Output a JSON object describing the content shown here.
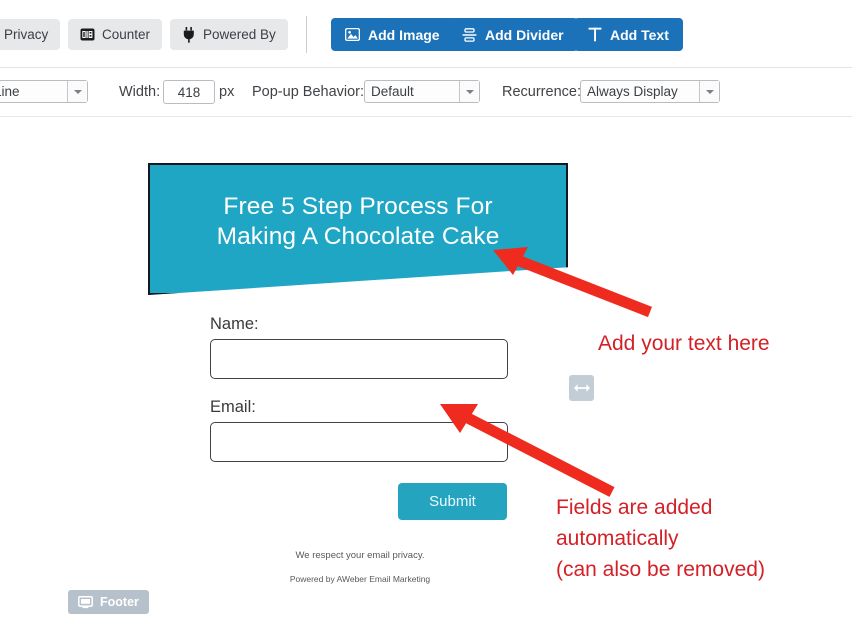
{
  "toolbar": {
    "buttons": [
      {
        "label": "Privacy",
        "icon": "none"
      },
      {
        "label": "Counter",
        "icon": "counter-icon"
      },
      {
        "label": "Powered By",
        "icon": "plug-icon"
      }
    ],
    "actions": [
      {
        "label": "Add Image",
        "icon": "image-icon"
      },
      {
        "label": "Add Divider",
        "icon": "divider-icon"
      },
      {
        "label": "Add Text",
        "icon": "text-icon"
      }
    ],
    "accent_blue": "#1c72b8",
    "chip_gray": "#e7e8ea"
  },
  "properties": {
    "line_style_value": "Line",
    "width_label": "Width:",
    "width_value": "418",
    "px_label": "px",
    "popup_label": "Pop-up Behavior:",
    "popup_value": "Default",
    "recurrence_label": "Recurrence:",
    "recurrence_value": "Always Display"
  },
  "canvas": {
    "banner": {
      "title_line1": "Free 5 Step Process For",
      "title_line2": "Making A Chocolate Cake",
      "background_color": "#1fa6c4",
      "text_color": "#ffffff"
    },
    "form": {
      "name_label": "Name:",
      "name_value": "",
      "name_placeholder": "",
      "email_label": "Email:",
      "email_value": "",
      "email_placeholder": "",
      "submit_label": "Submit",
      "submit_color": "#25a4c0"
    },
    "fine_print": {
      "privacy": "We respect your email privacy.",
      "powered_by": "Powered by AWeber Email Marketing"
    },
    "footer_badge": {
      "label": "Footer",
      "icon": "monitor-icon"
    },
    "resize_handle": {
      "icon": "horizontal-resize-icon"
    }
  },
  "annotations": {
    "color": "#d42027",
    "note_1": "Add your text here",
    "note_2_line1": "Fields are added",
    "note_2_line2": "automatically",
    "note_2_line3": "(can also be removed)"
  }
}
